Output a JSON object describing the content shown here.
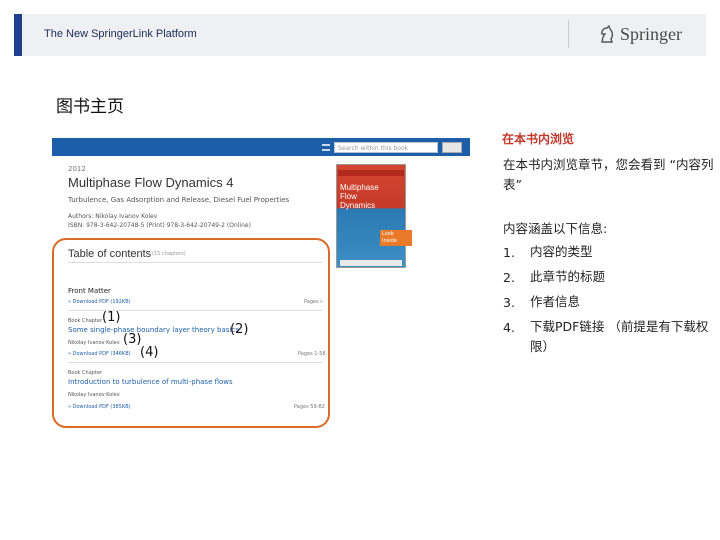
{
  "header": {
    "title": "The New SpringerLink Platform",
    "logo_text": "Springer"
  },
  "page_title": "图书主页",
  "screenshot": {
    "search_placeholder": "Search within this book",
    "year": "2012",
    "book_title": "Multiphase Flow Dynamics 4",
    "book_subtitle": "Turbulence, Gas Adsorption and Release, Diesel Fuel Properties",
    "authors": "Authors: Nikolay Ivanov Kolev",
    "isbn": "ISBN: 978-3-642-20748-5 (Print) 978-3-642-20749-2 (Online)",
    "cover_lines": [
      "Multiphase",
      "Flow",
      "Dynamics"
    ],
    "cover_button": "Look Inside",
    "toc_heading": "Table of contents",
    "toc_count": "(15 chapters)",
    "front_matter": "Front Matter",
    "entries": [
      {
        "pdf": "» Download PDF (192KB)",
        "pages": "Pages i-"
      },
      {
        "type": "Book Chapter",
        "title": "Some single-phase boundary layer theory basics",
        "author": "Nikolay Ivanov Kolev",
        "pdf": "» Download PDF (346KB)",
        "pages": "Pages 1-58"
      },
      {
        "type": "Book Chapter",
        "title": "Introduction to turbulence of multi-phase flows",
        "author": "Nikolay Ivanov Kolev",
        "pdf": "» Download PDF (385KB)",
        "pages": "Pages 59-82"
      }
    ]
  },
  "markers": {
    "m1": "(1)",
    "m2": "(2)",
    "m3": "(3)",
    "m4": "(4)"
  },
  "side": {
    "heading": "在本书内浏览",
    "desc": "在本书内浏览章节，您会看到 “内容列表”",
    "intro": "内容涵盖以下信息:",
    "items": [
      {
        "num": "1.",
        "text": "内容的类型"
      },
      {
        "num": "2.",
        "text": "此章节的标题"
      },
      {
        "num": "3.",
        "text": "作者信息"
      },
      {
        "num": "4.",
        "text": "下载PDF链接 （前提是有下载权限）"
      }
    ]
  },
  "colors": {
    "accent": "#1f3f8f",
    "frame": "#d96b26",
    "heading_red": "#c0392b",
    "link_blue": "#1c5fa8"
  }
}
